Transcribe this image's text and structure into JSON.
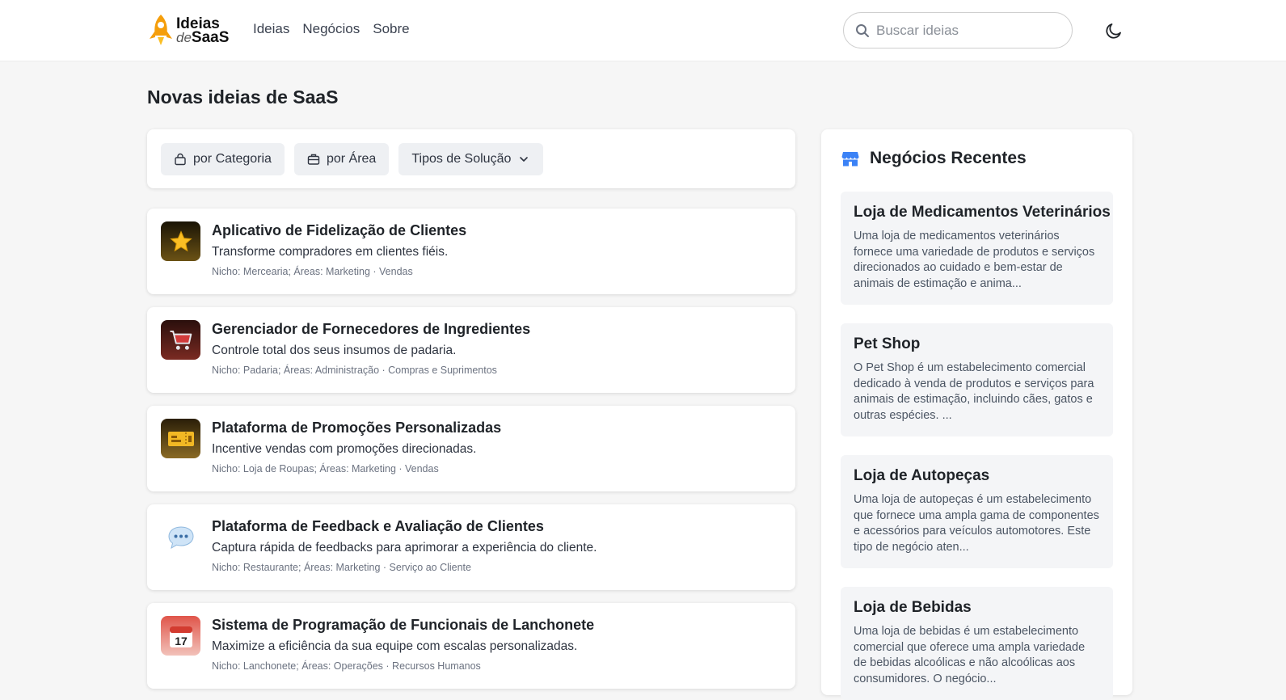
{
  "header": {
    "logo_line1": "Ideias",
    "logo_de": "de",
    "logo_saas": "SaaS",
    "nav": [
      {
        "label": "Ideias"
      },
      {
        "label": "Negócios"
      },
      {
        "label": "Sobre"
      }
    ],
    "search_placeholder": "Buscar ideias",
    "theme_icon": "moon-icon"
  },
  "main": {
    "title": "Novas ideias de SaaS",
    "filters": [
      {
        "label": "por Categoria",
        "icon": "bag-icon"
      },
      {
        "label": "por Área",
        "icon": "briefcase-icon"
      },
      {
        "label": "Tipos de Solução",
        "icon": "chevron-down-icon"
      }
    ],
    "ideas": [
      {
        "title": "Aplicativo de Fidelização de Clientes",
        "description": "Transforme compradores em clientes fiéis.",
        "meta": "Nicho: Mercearia; Áreas: Marketing · Vendas",
        "icon": "star-icon",
        "icon_glyph": "⭐",
        "icon_bg": "#4a3a10"
      },
      {
        "title": "Gerenciador de Fornecedores de Ingredientes",
        "description": "Controle total dos seus insumos de padaria.",
        "meta": "Nicho: Padaria; Áreas: Administração · Compras e Suprimentos",
        "icon": "shopping-cart-icon",
        "icon_glyph": "🛒",
        "icon_bg": "#5a1f1a"
      },
      {
        "title": "Plataforma de Promoções Personalizadas",
        "description": "Incentive vendas com promoções direcionadas.",
        "meta": "Nicho: Loja de Roupas; Áreas: Marketing · Vendas",
        "icon": "ticket-icon",
        "icon_glyph": "🎫",
        "icon_bg": "#5a4418"
      },
      {
        "title": "Plataforma de Feedback e Avaliação de Clientes",
        "description": "Captura rápida de feedbacks para aprimorar a experiência do cliente.",
        "meta": "Nicho: Restaurante; Áreas: Marketing · Serviço ao Cliente",
        "icon": "speech-bubble-icon",
        "icon_glyph": "💬",
        "icon_bg": "#ffffff"
      },
      {
        "title": "Sistema de Programação de Funcionais de Lanchonete",
        "description": "Maximize a eficiência da sua equipe com escalas personalizadas.",
        "meta": "Nicho: Lanchonete; Áreas: Operações · Recursos Humanos",
        "icon": "calendar-icon",
        "icon_glyph": "📅",
        "icon_bg": "#e8a49a"
      }
    ]
  },
  "sidebar": {
    "title": "Negócios Recentes",
    "icon": "store-icon",
    "businesses": [
      {
        "title": "Loja de Medicamentos Veterinários",
        "description": "Uma loja de medicamentos veterinários fornece uma variedade de produtos e serviços direcionados ao cuidado e bem-estar de animais de estimação e anima..."
      },
      {
        "title": "Pet Shop",
        "description": "O Pet Shop é um estabelecimento comercial dedicado à venda de produtos e serviços para animais de estimação, incluindo cães, gatos e outras espécies. ..."
      },
      {
        "title": "Loja de Autopeças",
        "description": "Uma loja de autopeças é um estabelecimento que fornece uma ampla gama de componentes e acessórios para veículos automotores. Este tipo de negócio aten..."
      },
      {
        "title": "Loja de Bebidas",
        "description": "Uma loja de bebidas é um estabelecimento comercial que oferece uma ampla variedade de bebidas alcoólicas e não alcoólicas aos consumidores. O negócio..."
      }
    ]
  },
  "colors": {
    "accent": "#f59e0b",
    "store_icon": "#3b82f6"
  }
}
